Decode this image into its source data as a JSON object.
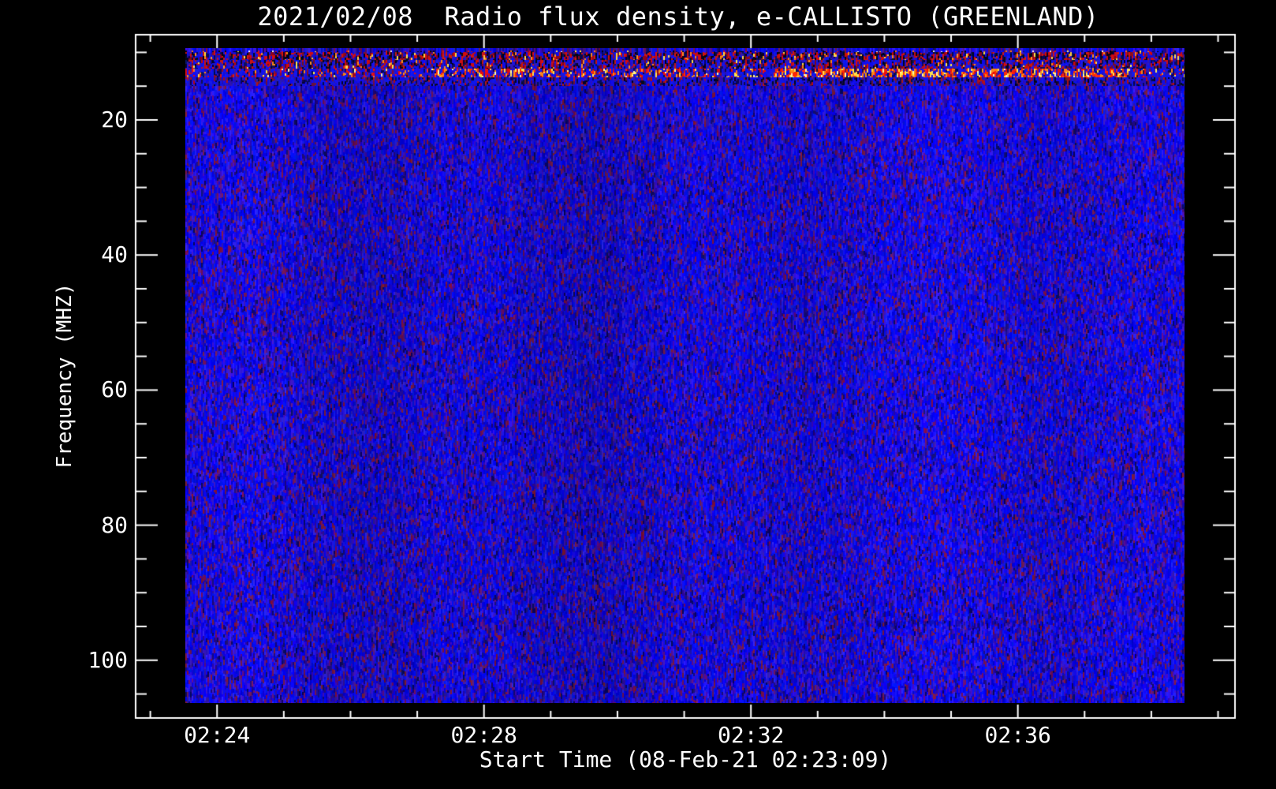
{
  "chart_data": {
    "type": "heatmap",
    "subtype": "radio-spectrogram",
    "title": "2021/02/08  Radio flux density, e-CALLISTO (GREENLAND)",
    "xlabel": "Start Time (08-Feb-21 02:23:09)",
    "ylabel": "Frequency (MHZ)",
    "x_tick_labels": [
      "02:24",
      "02:28",
      "02:32",
      "02:36"
    ],
    "x_major_tick_interval_min": 4,
    "x_minor_tick_interval_min": 1,
    "y_tick_labels": [
      "20",
      "40",
      "60",
      "80",
      "100"
    ],
    "y_major_tick_interval_mhz": 20,
    "y_minor_tick_interval_mhz": 5,
    "y_axis_orientation": "inverted (low frequency at top)",
    "x_range_time": [
      "02:22:47",
      "02:39:16"
    ],
    "y_range_mhz": [
      7.4,
      108.5
    ],
    "data_extent": {
      "time_start": "02:23:30",
      "time_end": "02:38:30",
      "freq_min_mhz": 9.4,
      "freq_max_mhz": 106.3
    },
    "grid": "off",
    "legend": "none",
    "frame_color": "#ffffff",
    "background_color": "#000000",
    "text_color": "#ffffff",
    "noise_field": {
      "description": "dense vertical-dash blue noise with sparse purple / dark-red speckles",
      "palette": [
        {
          "color": "#0909f2",
          "weight": 0.34,
          "jitter": 18
        },
        {
          "color": "#0404d8",
          "weight": 0.16,
          "jitter": 16
        },
        {
          "color": "#2a1af0",
          "weight": 0.12,
          "jitter": 14
        },
        {
          "color": "#3a14c8",
          "weight": 0.1,
          "jitter": 14
        },
        {
          "color": "#2d0fa6",
          "weight": 0.08,
          "jitter": 12
        },
        {
          "color": "#1a0b80",
          "weight": 0.06,
          "jitter": 10
        },
        {
          "color": "#5c1288",
          "weight": 0.045,
          "jitter": 12
        },
        {
          "color": "#701455",
          "weight": 0.045,
          "jitter": 12
        },
        {
          "color": "#7e163a",
          "weight": 0.03,
          "jitter": 10
        },
        {
          "color": "#0c0862",
          "weight": 0.03,
          "jitter": 8
        }
      ]
    },
    "rfi_bands": [
      {
        "name": "top-speckle-line",
        "freq_mhz": [
          9.4,
          9.9
        ],
        "palette": [
          {
            "color": "#000008",
            "weight": 0.25
          },
          {
            "color": "#1414f0",
            "weight": 0.3
          },
          {
            "color": "#e01010",
            "weight": 0.14
          },
          {
            "color": "#ff7a10",
            "weight": 0.08
          },
          {
            "color": "#ffe24a",
            "weight": 0.07
          },
          {
            "color": "#f2f2f2",
            "weight": 0.04
          },
          {
            "color": "#0a0a50",
            "weight": 0.12
          }
        ]
      },
      {
        "name": "dark-rfi-band",
        "freq_mhz": [
          9.9,
          11.1
        ],
        "palette": [
          {
            "color": "#d01010",
            "weight": 0.2
          },
          {
            "color": "#8a0a20",
            "weight": 0.12
          },
          {
            "color": "#05051a",
            "weight": 0.18
          },
          {
            "color": "#0a0a55",
            "weight": 0.12
          },
          {
            "color": "#1010e8",
            "weight": 0.22
          },
          {
            "color": "#2a14b0",
            "weight": 0.1
          },
          {
            "color": "#ff8c1e",
            "weight": 0.03
          },
          {
            "color": "#ffd84a",
            "weight": 0.03
          }
        ]
      },
      {
        "name": "mixed-rfi-band",
        "freq_mhz": [
          11.1,
          12.3
        ],
        "palette": [
          {
            "color": "#cc1010",
            "weight": 0.15
          },
          {
            "color": "#7a0a24",
            "weight": 0.1
          },
          {
            "color": "#05051e",
            "weight": 0.14
          },
          {
            "color": "#0c0c60",
            "weight": 0.12
          },
          {
            "color": "#1212ec",
            "weight": 0.3
          },
          {
            "color": "#2c16b8",
            "weight": 0.16
          },
          {
            "color": "#ff8c1e",
            "weight": 0.02
          },
          {
            "color": "#ffe04e",
            "weight": 0.01
          }
        ]
      },
      {
        "name": "hot-rfi-band",
        "freq_mhz": [
          12.3,
          13.6
        ],
        "palette": [
          {
            "color": "#e41010",
            "weight": 0.13
          },
          {
            "color": "#8c0c2a",
            "weight": 0.08
          },
          {
            "color": "#0a0a58",
            "weight": 0.1
          },
          {
            "color": "#1212ee",
            "weight": 0.4
          },
          {
            "color": "#2c16b8",
            "weight": 0.21
          },
          {
            "color": "#ff8618",
            "weight": 0.04
          },
          {
            "color": "#ffe44e",
            "weight": 0.03
          },
          {
            "color": "#fff7a0",
            "weight": 0.01
          }
        ],
        "hot_colors": [
          {
            "color": "#ff2a06",
            "weight": 5
          },
          {
            "color": "#ff8c14",
            "weight": 3
          },
          {
            "color": "#ffe44e",
            "weight": 2
          },
          {
            "color": "#fff9b0",
            "weight": 1
          }
        ],
        "hot_segments": [
          {
            "time": [
              "02:32:20",
              "02:37:40"
            ],
            "x_frac": [
              0.588,
              0.943
            ],
            "boost": 3.8
          },
          {
            "time": [
              "02:27:10",
              "02:31:20"
            ],
            "x_frac": [
              0.241,
              0.525
            ],
            "boost": 1.6
          }
        ]
      },
      {
        "name": "transition-band",
        "freq_mhz": [
          13.6,
          14.9
        ],
        "palette": [
          {
            "color": "#b01018",
            "weight": 0.07
          },
          {
            "color": "#70123a",
            "weight": 0.08
          },
          {
            "color": "#0a0a55",
            "weight": 0.16
          },
          {
            "color": "#1111ea",
            "weight": 0.4
          },
          {
            "color": "#2a14b4",
            "weight": 0.22
          },
          {
            "color": "#05051e",
            "weight": 0.07
          }
        ]
      },
      {
        "name": "fm-dark-patch",
        "freq_mhz": [
          94.1,
          95.0
        ],
        "time": [
          "02:33:31",
          "02:36:07"
        ],
        "x_frac": [
          0.667,
          0.841
        ],
        "darken": 0.78
      }
    ]
  }
}
